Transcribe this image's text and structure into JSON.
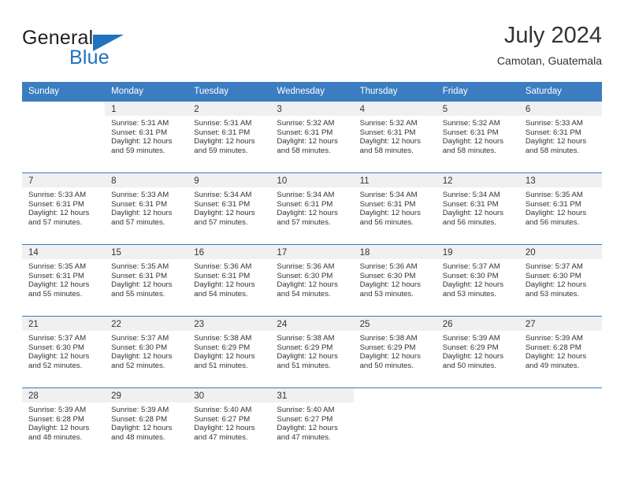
{
  "brand": {
    "name_top": "General",
    "name_bottom": "Blue",
    "accent_color": "#1e73be"
  },
  "header": {
    "title": "July 2024",
    "subtitle": "Camotan, Guatemala"
  },
  "calendar": {
    "header_bg": "#3b7dc0",
    "daynum_bg": "#f0f0f0",
    "weekdays": [
      "Sunday",
      "Monday",
      "Tuesday",
      "Wednesday",
      "Thursday",
      "Friday",
      "Saturday"
    ],
    "weeks": [
      [
        {
          "day": "",
          "sunrise": "",
          "sunset": "",
          "daylight1": "",
          "daylight2": "",
          "blank": true
        },
        {
          "day": "1",
          "sunrise": "Sunrise: 5:31 AM",
          "sunset": "Sunset: 6:31 PM",
          "daylight1": "Daylight: 12 hours",
          "daylight2": "and 59 minutes."
        },
        {
          "day": "2",
          "sunrise": "Sunrise: 5:31 AM",
          "sunset": "Sunset: 6:31 PM",
          "daylight1": "Daylight: 12 hours",
          "daylight2": "and 59 minutes."
        },
        {
          "day": "3",
          "sunrise": "Sunrise: 5:32 AM",
          "sunset": "Sunset: 6:31 PM",
          "daylight1": "Daylight: 12 hours",
          "daylight2": "and 58 minutes."
        },
        {
          "day": "4",
          "sunrise": "Sunrise: 5:32 AM",
          "sunset": "Sunset: 6:31 PM",
          "daylight1": "Daylight: 12 hours",
          "daylight2": "and 58 minutes."
        },
        {
          "day": "5",
          "sunrise": "Sunrise: 5:32 AM",
          "sunset": "Sunset: 6:31 PM",
          "daylight1": "Daylight: 12 hours",
          "daylight2": "and 58 minutes."
        },
        {
          "day": "6",
          "sunrise": "Sunrise: 5:33 AM",
          "sunset": "Sunset: 6:31 PM",
          "daylight1": "Daylight: 12 hours",
          "daylight2": "and 58 minutes."
        }
      ],
      [
        {
          "day": "7",
          "sunrise": "Sunrise: 5:33 AM",
          "sunset": "Sunset: 6:31 PM",
          "daylight1": "Daylight: 12 hours",
          "daylight2": "and 57 minutes."
        },
        {
          "day": "8",
          "sunrise": "Sunrise: 5:33 AM",
          "sunset": "Sunset: 6:31 PM",
          "daylight1": "Daylight: 12 hours",
          "daylight2": "and 57 minutes."
        },
        {
          "day": "9",
          "sunrise": "Sunrise: 5:34 AM",
          "sunset": "Sunset: 6:31 PM",
          "daylight1": "Daylight: 12 hours",
          "daylight2": "and 57 minutes."
        },
        {
          "day": "10",
          "sunrise": "Sunrise: 5:34 AM",
          "sunset": "Sunset: 6:31 PM",
          "daylight1": "Daylight: 12 hours",
          "daylight2": "and 57 minutes."
        },
        {
          "day": "11",
          "sunrise": "Sunrise: 5:34 AM",
          "sunset": "Sunset: 6:31 PM",
          "daylight1": "Daylight: 12 hours",
          "daylight2": "and 56 minutes."
        },
        {
          "day": "12",
          "sunrise": "Sunrise: 5:34 AM",
          "sunset": "Sunset: 6:31 PM",
          "daylight1": "Daylight: 12 hours",
          "daylight2": "and 56 minutes."
        },
        {
          "day": "13",
          "sunrise": "Sunrise: 5:35 AM",
          "sunset": "Sunset: 6:31 PM",
          "daylight1": "Daylight: 12 hours",
          "daylight2": "and 56 minutes."
        }
      ],
      [
        {
          "day": "14",
          "sunrise": "Sunrise: 5:35 AM",
          "sunset": "Sunset: 6:31 PM",
          "daylight1": "Daylight: 12 hours",
          "daylight2": "and 55 minutes."
        },
        {
          "day": "15",
          "sunrise": "Sunrise: 5:35 AM",
          "sunset": "Sunset: 6:31 PM",
          "daylight1": "Daylight: 12 hours",
          "daylight2": "and 55 minutes."
        },
        {
          "day": "16",
          "sunrise": "Sunrise: 5:36 AM",
          "sunset": "Sunset: 6:31 PM",
          "daylight1": "Daylight: 12 hours",
          "daylight2": "and 54 minutes."
        },
        {
          "day": "17",
          "sunrise": "Sunrise: 5:36 AM",
          "sunset": "Sunset: 6:30 PM",
          "daylight1": "Daylight: 12 hours",
          "daylight2": "and 54 minutes."
        },
        {
          "day": "18",
          "sunrise": "Sunrise: 5:36 AM",
          "sunset": "Sunset: 6:30 PM",
          "daylight1": "Daylight: 12 hours",
          "daylight2": "and 53 minutes."
        },
        {
          "day": "19",
          "sunrise": "Sunrise: 5:37 AM",
          "sunset": "Sunset: 6:30 PM",
          "daylight1": "Daylight: 12 hours",
          "daylight2": "and 53 minutes."
        },
        {
          "day": "20",
          "sunrise": "Sunrise: 5:37 AM",
          "sunset": "Sunset: 6:30 PM",
          "daylight1": "Daylight: 12 hours",
          "daylight2": "and 53 minutes."
        }
      ],
      [
        {
          "day": "21",
          "sunrise": "Sunrise: 5:37 AM",
          "sunset": "Sunset: 6:30 PM",
          "daylight1": "Daylight: 12 hours",
          "daylight2": "and 52 minutes."
        },
        {
          "day": "22",
          "sunrise": "Sunrise: 5:37 AM",
          "sunset": "Sunset: 6:30 PM",
          "daylight1": "Daylight: 12 hours",
          "daylight2": "and 52 minutes."
        },
        {
          "day": "23",
          "sunrise": "Sunrise: 5:38 AM",
          "sunset": "Sunset: 6:29 PM",
          "daylight1": "Daylight: 12 hours",
          "daylight2": "and 51 minutes."
        },
        {
          "day": "24",
          "sunrise": "Sunrise: 5:38 AM",
          "sunset": "Sunset: 6:29 PM",
          "daylight1": "Daylight: 12 hours",
          "daylight2": "and 51 minutes."
        },
        {
          "day": "25",
          "sunrise": "Sunrise: 5:38 AM",
          "sunset": "Sunset: 6:29 PM",
          "daylight1": "Daylight: 12 hours",
          "daylight2": "and 50 minutes."
        },
        {
          "day": "26",
          "sunrise": "Sunrise: 5:39 AM",
          "sunset": "Sunset: 6:29 PM",
          "daylight1": "Daylight: 12 hours",
          "daylight2": "and 50 minutes."
        },
        {
          "day": "27",
          "sunrise": "Sunrise: 5:39 AM",
          "sunset": "Sunset: 6:28 PM",
          "daylight1": "Daylight: 12 hours",
          "daylight2": "and 49 minutes."
        }
      ],
      [
        {
          "day": "28",
          "sunrise": "Sunrise: 5:39 AM",
          "sunset": "Sunset: 6:28 PM",
          "daylight1": "Daylight: 12 hours",
          "daylight2": "and 48 minutes."
        },
        {
          "day": "29",
          "sunrise": "Sunrise: 5:39 AM",
          "sunset": "Sunset: 6:28 PM",
          "daylight1": "Daylight: 12 hours",
          "daylight2": "and 48 minutes."
        },
        {
          "day": "30",
          "sunrise": "Sunrise: 5:40 AM",
          "sunset": "Sunset: 6:27 PM",
          "daylight1": "Daylight: 12 hours",
          "daylight2": "and 47 minutes."
        },
        {
          "day": "31",
          "sunrise": "Sunrise: 5:40 AM",
          "sunset": "Sunset: 6:27 PM",
          "daylight1": "Daylight: 12 hours",
          "daylight2": "and 47 minutes."
        },
        {
          "day": "",
          "sunrise": "",
          "sunset": "",
          "daylight1": "",
          "daylight2": "",
          "blank": true
        },
        {
          "day": "",
          "sunrise": "",
          "sunset": "",
          "daylight1": "",
          "daylight2": "",
          "blank": true
        },
        {
          "day": "",
          "sunrise": "",
          "sunset": "",
          "daylight1": "",
          "daylight2": "",
          "blank": true
        }
      ]
    ]
  }
}
